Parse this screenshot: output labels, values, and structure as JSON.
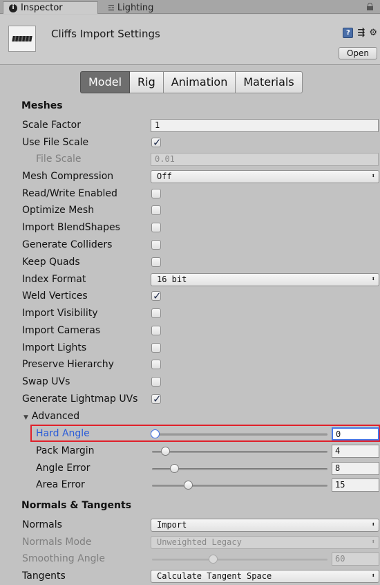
{
  "tabs": [
    {
      "label": "Inspector",
      "icon": "info-icon"
    },
    {
      "label": "Lighting",
      "icon": "lighting-icon"
    }
  ],
  "header": {
    "title": "Cliffs Import Settings",
    "open_label": "Open"
  },
  "subtabs": [
    "Model",
    "Rig",
    "Animation",
    "Materials"
  ],
  "active_subtab": "Model",
  "meshes": {
    "section_title": "Meshes",
    "scale_factor": {
      "label": "Scale Factor",
      "value": "1"
    },
    "use_file_scale": {
      "label": "Use File Scale",
      "checked": true
    },
    "file_scale": {
      "label": "File Scale",
      "value": "0.01"
    },
    "mesh_compression": {
      "label": "Mesh Compression",
      "value": "Off"
    },
    "read_write": {
      "label": "Read/Write Enabled",
      "checked": false
    },
    "optimize_mesh": {
      "label": "Optimize Mesh",
      "checked": false
    },
    "import_blendshapes": {
      "label": "Import BlendShapes",
      "checked": false
    },
    "generate_colliders": {
      "label": "Generate Colliders",
      "checked": false
    },
    "keep_quads": {
      "label": "Keep Quads",
      "checked": false
    },
    "index_format": {
      "label": "Index Format",
      "value": "16 bit"
    },
    "weld_vertices": {
      "label": "Weld Vertices",
      "checked": true
    },
    "import_visibility": {
      "label": "Import Visibility",
      "checked": false
    },
    "import_cameras": {
      "label": "Import Cameras",
      "checked": false
    },
    "import_lights": {
      "label": "Import Lights",
      "checked": false
    },
    "preserve_hierarchy": {
      "label": "Preserve Hierarchy",
      "checked": false
    },
    "swap_uvs": {
      "label": "Swap UVs",
      "checked": false
    },
    "generate_lightmap_uvs": {
      "label": "Generate Lightmap UVs",
      "checked": true
    }
  },
  "advanced": {
    "label": "Advanced",
    "hard_angle": {
      "label": "Hard Angle",
      "value": "0",
      "fraction": 0.0
    },
    "pack_margin": {
      "label": "Pack Margin",
      "value": "4",
      "fraction": 0.06
    },
    "angle_error": {
      "label": "Angle Error",
      "value": "8",
      "fraction": 0.11
    },
    "area_error": {
      "label": "Area Error",
      "value": "15",
      "fraction": 0.19
    }
  },
  "normals": {
    "section_title": "Normals & Tangents",
    "normals": {
      "label": "Normals",
      "value": "Import"
    },
    "normals_mode": {
      "label": "Normals Mode",
      "value": "Unweighted Legacy"
    },
    "smoothing_angle": {
      "label": "Smoothing Angle",
      "value": "60",
      "fraction": 0.33
    },
    "tangents": {
      "label": "Tangents",
      "value": "Calculate Tangent Space"
    }
  },
  "colors": {
    "highlight": "#e0202a",
    "focus_text": "#2a5cd8",
    "active_subtab_bg": "#6e6e6e",
    "panel_bg": "#c2c2c2"
  }
}
